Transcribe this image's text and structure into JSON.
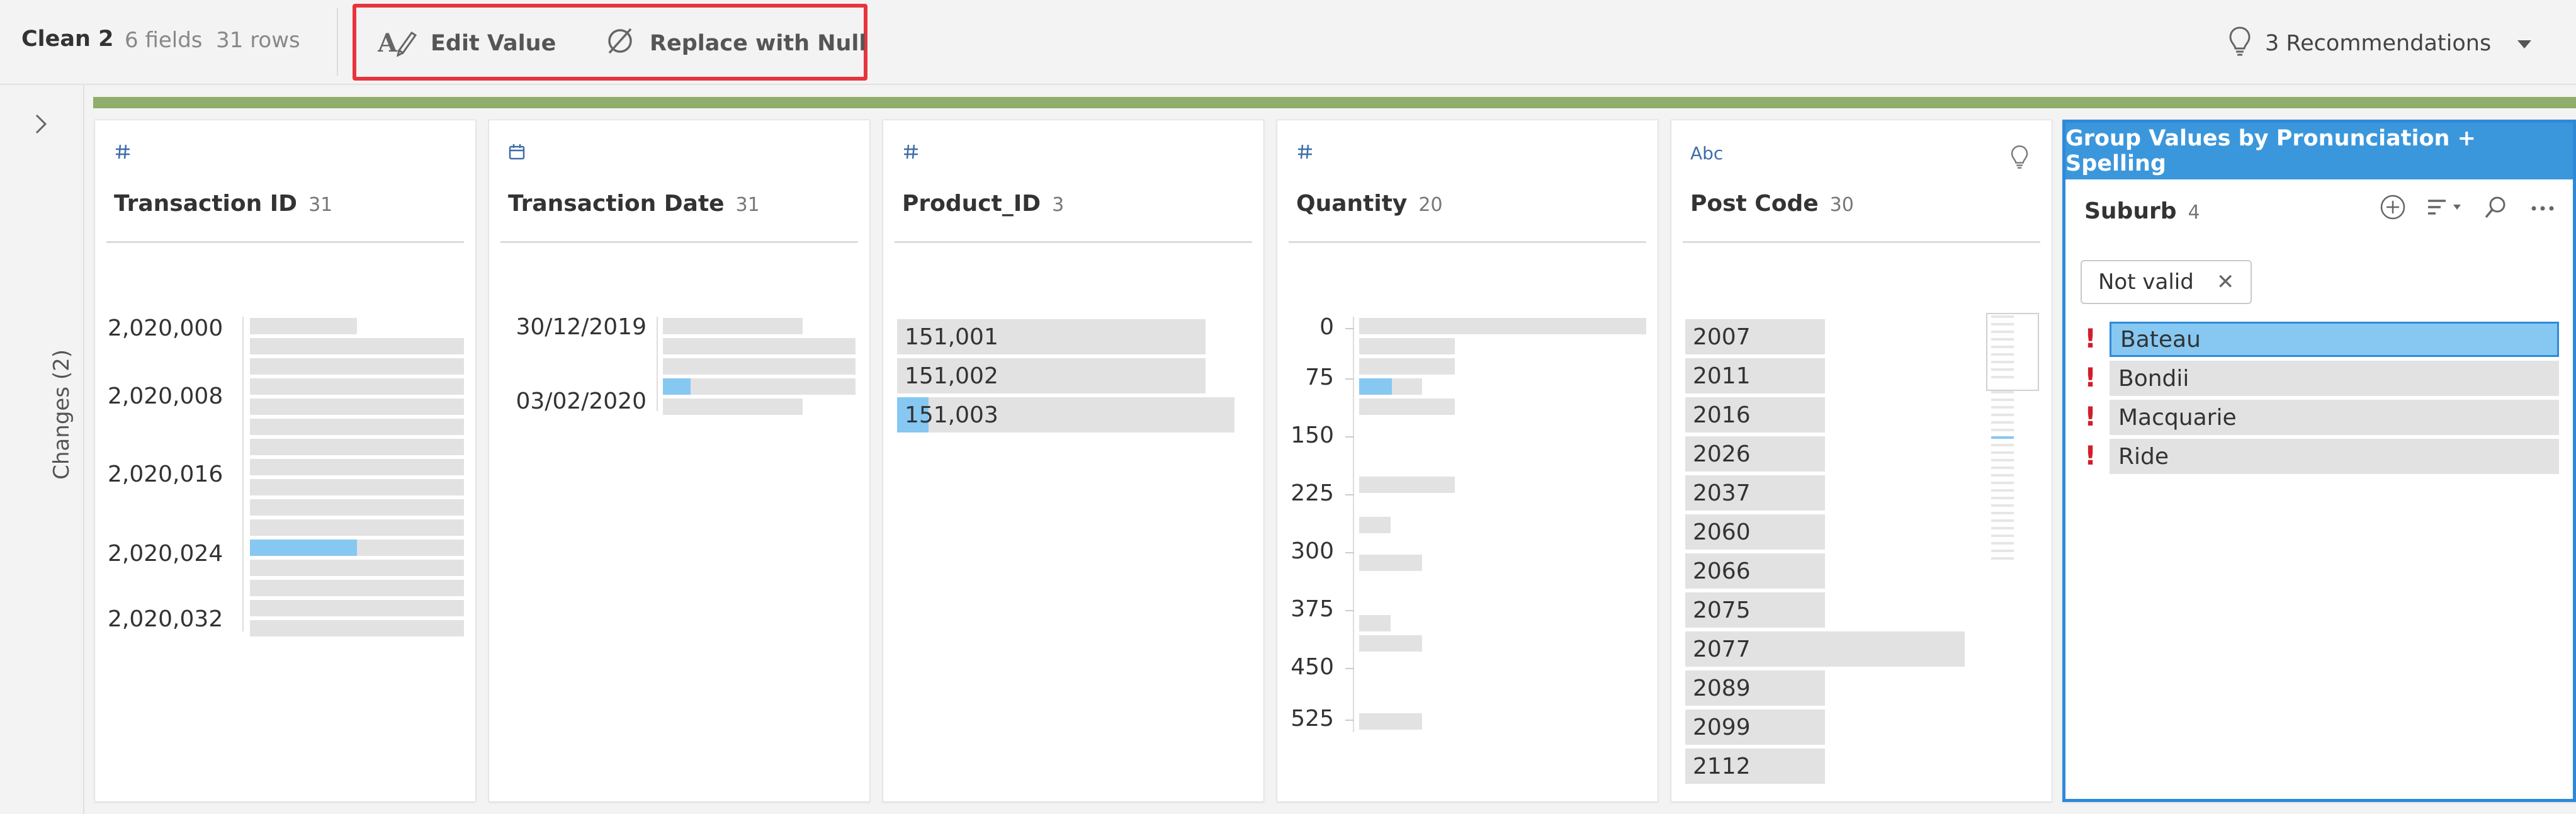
{
  "toolbar": {
    "step_name": "Clean 2",
    "meta": "6 fields  31 rows",
    "edit_value": "Edit Value",
    "replace_null": "Replace with Null",
    "recommendations": "3 Recommendations"
  },
  "rail": {
    "changes_label": "Changes (2)"
  },
  "colors": {
    "accent": "#3b97dc",
    "highlight_box": "#e8343c",
    "selected_bar": "#86c8f2",
    "progress_bar": "#8fae6b",
    "invalid": "#d21e2b"
  },
  "cards": {
    "transaction_id": {
      "type_icon": "number-icon",
      "name": "Transaction ID",
      "count": "31",
      "axis": [
        "2,020,000",
        "2,020,008",
        "2,020,016",
        "2,020,024",
        "2,020,032"
      ]
    },
    "transaction_date": {
      "type_icon": "calendar-icon",
      "name": "Transaction Date",
      "count": "31",
      "axis": [
        "30/12/2019",
        "03/02/2020"
      ]
    },
    "product_id": {
      "type_icon": "number-icon",
      "name": "Product_ID",
      "count": "3",
      "values": [
        "151,001",
        "151,002",
        "151,003"
      ]
    },
    "quantity": {
      "type_icon": "number-icon",
      "name": "Quantity",
      "count": "20",
      "axis": [
        "0",
        "75",
        "150",
        "225",
        "300",
        "375",
        "450",
        "525"
      ]
    },
    "post_code": {
      "type_icon": "text-type-icon",
      "type_label": "Abc",
      "name": "Post Code",
      "count": "30",
      "values": [
        "2007",
        "2011",
        "2016",
        "2026",
        "2037",
        "2060",
        "2066",
        "2075",
        "2077",
        "2089",
        "2099",
        "2112"
      ]
    },
    "suburb": {
      "group_header": "Group Values by Pronunciation + Spelling",
      "name": "Suburb",
      "count": "4",
      "filter_pill": "Not valid",
      "values": [
        "Bateau",
        "Bondii",
        "Macquarie",
        "Ride"
      ],
      "selected": "Bateau"
    }
  }
}
